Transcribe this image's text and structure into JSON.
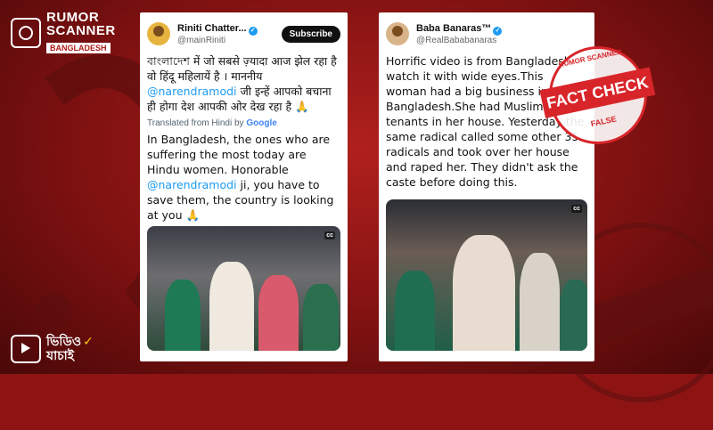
{
  "brand": {
    "name_line1": "RUMOR",
    "name_line2": "SCANNER",
    "subtitle": "BANGLADESH"
  },
  "video_brand": {
    "line1": "ভিডিও",
    "line2": "যাচাই"
  },
  "tweets": [
    {
      "name": "Riniti Chatter...",
      "handle": "@mainRiniti",
      "subscribe_label": "Subscribe",
      "original_text_part1": "বাংলাদেশ में जो सबसे ज़्यादा आज झेल रहा है वो हिंदू महिलायें है । माननीय",
      "original_mention": "@narendramodi",
      "original_text_part2": " जी इन्हें आपको बचाना ही होगा देश आपकी ओर देख रहा है 🙏",
      "translated_label": "Translated from Hindi by",
      "translated_by": "Google",
      "text_part1": "In Bangladesh, the ones who are suffering the most today are Hindu women. Honorable ",
      "mention": "@narendramodi",
      "text_part2": " ji, you have to save them, the country is looking at you 🙏",
      "media_badge": "cc"
    },
    {
      "name": "Baba Banaras™",
      "handle": "@RealBababanaras",
      "text": "Horrific video is from Bangladesh, watch it with wide eyes.This woman had a big business in Bangladesh.She had Muslim tenants in her house. Yesterday the same radical called some other 35 radicals and took over her house and raped her. They didn't ask the caste before doing this.",
      "media_badge": "cc"
    }
  ],
  "stamp": {
    "top": "RUMOR SCANNER",
    "center": "FACT CHECK",
    "bottom": "FALSE"
  },
  "colors": {
    "background": "#8e1414",
    "accent": "#d8252a",
    "link": "#1d9bf0"
  }
}
